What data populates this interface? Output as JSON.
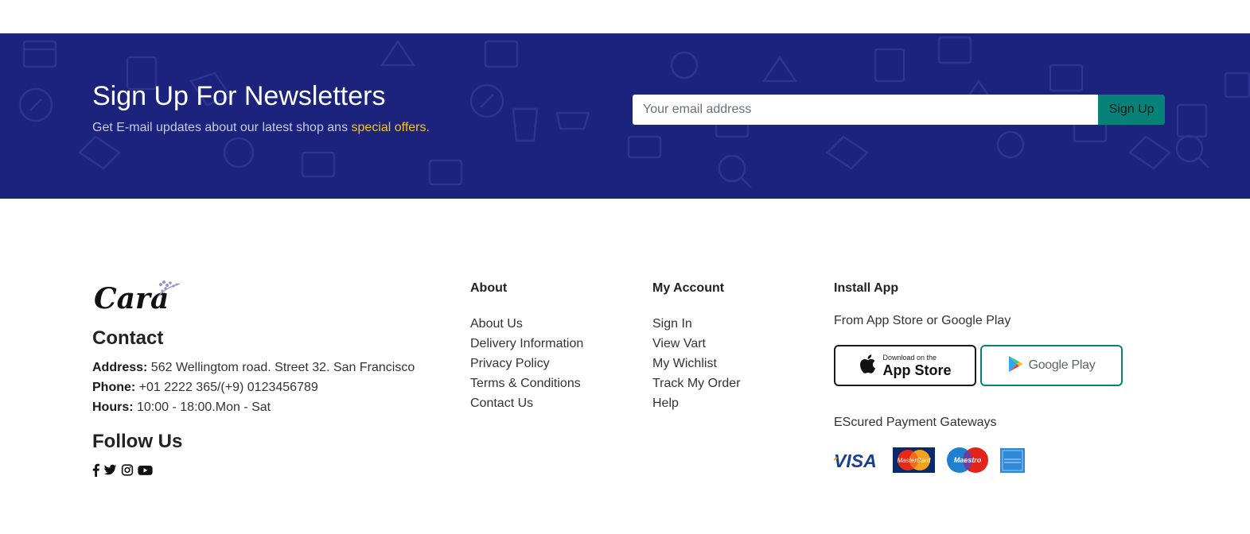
{
  "newsletter": {
    "title": "Sign Up For Newsletters",
    "subtitle_prefix": "Get E-mail updates about our latest shop ans ",
    "subtitle_highlight": "special offers.",
    "email_placeholder": "Your email address",
    "button_label": "Sign Up"
  },
  "contact": {
    "title": "Contact",
    "address_label": "Address:",
    "address_value": " 562 Wellingtom road. Street 32. San Francisco",
    "phone_label": "Phone:",
    "phone_value": " +01 2222 365/(+9) 0123456789",
    "hours_label": "Hours:",
    "hours_value": " 10:00 - 18:00.Mon - Sat"
  },
  "follow": {
    "title": "Follow Us",
    "icons": [
      "facebook-icon",
      "twitter-icon",
      "instagram-icon",
      "youtube-icon"
    ]
  },
  "about": {
    "title": "About",
    "links": [
      "About Us",
      "Delivery Information",
      "Privacy Policy",
      "Terms & Conditions",
      "Contact Us"
    ]
  },
  "account": {
    "title": "My Account",
    "links": [
      "Sign In",
      "View Vart",
      "My Wichlist",
      "Track My Order",
      "Help"
    ]
  },
  "install": {
    "title": "Install App",
    "subtitle": "From App Store or Google Play",
    "appstore_small": "Download on the",
    "appstore_big": "App Store",
    "googleplay_label": "Google Play",
    "payment_title": "EScured Payment Gateways",
    "payment_icons": [
      "visa-icon",
      "mastercard-icon",
      "maestro-icon",
      "amex-icon"
    ]
  },
  "colors": {
    "banner_bg": "#1b237d",
    "accent": "#088178",
    "highlight": "#f5c518"
  }
}
